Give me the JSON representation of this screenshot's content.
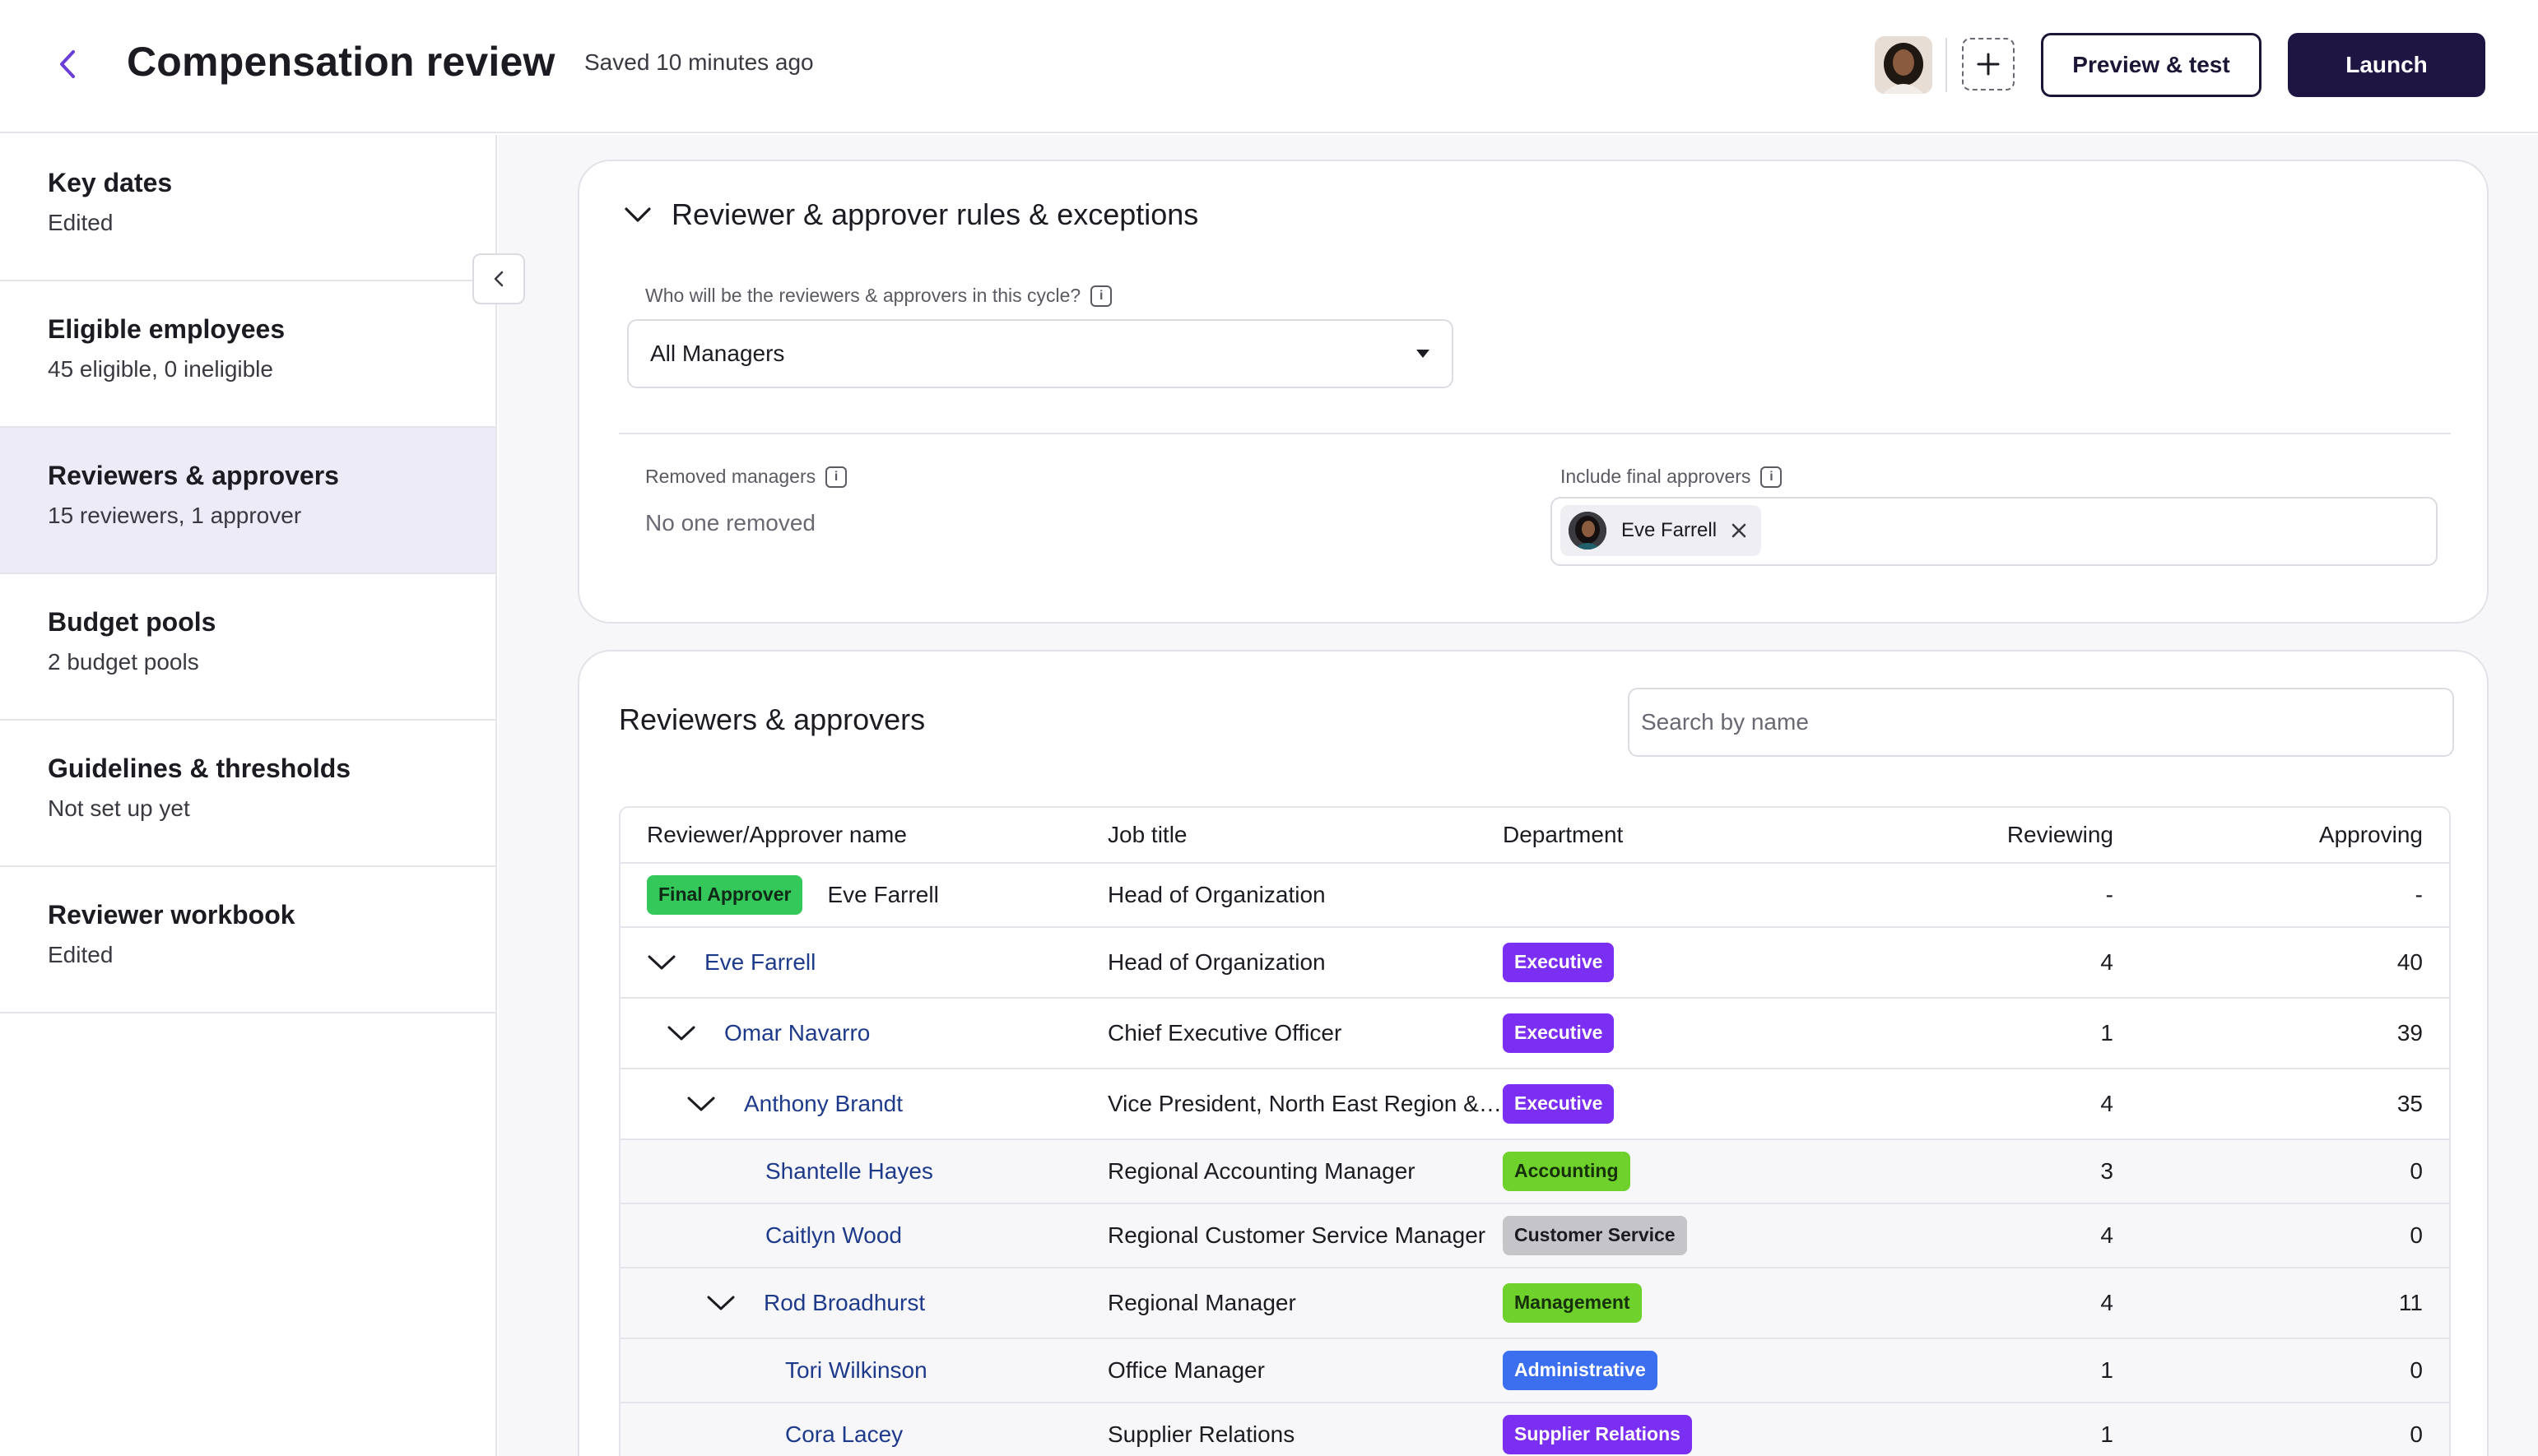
{
  "header": {
    "title": "Compensation review",
    "saved_status": "Saved 10 minutes ago",
    "preview_label": "Preview & test",
    "launch_label": "Launch"
  },
  "sidebar": {
    "items": [
      {
        "title": "Key dates",
        "subtitle": "Edited"
      },
      {
        "title": "Eligible employees",
        "subtitle": "45 eligible, 0 ineligible"
      },
      {
        "title": "Reviewers & approvers",
        "subtitle": "15 reviewers, 1 approver",
        "active": true
      },
      {
        "title": "Budget pools",
        "subtitle": "2 budget pools"
      },
      {
        "title": "Guidelines & thresholds",
        "subtitle": "Not set up yet"
      },
      {
        "title": "Reviewer workbook",
        "subtitle": "Edited"
      }
    ]
  },
  "rules": {
    "title": "Reviewer & approver rules & exceptions",
    "question": "Who will be the reviewers & approvers in this cycle?",
    "selected": "All Managers",
    "removed_label": "Removed managers",
    "removed_value": "No one removed",
    "final_label": "Include final approvers",
    "final_chip": "Eve Farrell"
  },
  "table": {
    "title": "Reviewers & approvers",
    "search_placeholder": "Search by name",
    "columns": {
      "name": "Reviewer/Approver name",
      "job": "Job title",
      "dept": "Department",
      "reviewing": "Reviewing",
      "approving": "Approving"
    },
    "final_badge": "Final Approver",
    "rows": [
      {
        "name": "Eve Farrell",
        "job": "Head of Organization",
        "dept": "",
        "reviewing": "-",
        "approving": "-"
      },
      {
        "name": "Eve Farrell",
        "job": "Head of Organization",
        "dept": "Executive",
        "reviewing": "4",
        "approving": "40"
      },
      {
        "name": "Omar Navarro",
        "job": "Chief Executive Officer",
        "dept": "Executive",
        "reviewing": "1",
        "approving": "39"
      },
      {
        "name": "Anthony Brandt",
        "job": "Vice President, North East Region & Operations",
        "dept": "Executive",
        "reviewing": "4",
        "approving": "35"
      },
      {
        "name": "Shantelle Hayes",
        "job": "Regional Accounting Manager",
        "dept": "Accounting",
        "reviewing": "3",
        "approving": "0"
      },
      {
        "name": "Caitlyn Wood",
        "job": "Regional Customer Service Manager",
        "dept": "Customer Service",
        "reviewing": "4",
        "approving": "0"
      },
      {
        "name": "Rod Broadhurst",
        "job": "Regional Manager",
        "dept": "Management",
        "reviewing": "4",
        "approving": "11"
      },
      {
        "name": "Tori Wilkinson",
        "job": "Office Manager",
        "dept": "Administrative",
        "reviewing": "1",
        "approving": "0"
      },
      {
        "name": "Cora Lacey",
        "job": "Supplier Relations",
        "dept": "Supplier Relations",
        "reviewing": "1",
        "approving": "0"
      }
    ]
  },
  "colors": {
    "accent": "#6b3fd6",
    "primary_button": "#1f1543",
    "active_nav": "#eeebf8",
    "executive": "#7b2ff2",
    "accounting": "#6fd12b",
    "customer_service": "#c5c4c9",
    "management": "#6fd12b",
    "administrative": "#3c6ef0",
    "final_approver": "#34c759"
  },
  "icons": {
    "back": "chevron-left-icon",
    "add": "plus-icon",
    "collapse": "chevron-left-icon",
    "section_toggle": "chevron-down-icon",
    "dropdown": "caret-down-icon",
    "info": "info-icon",
    "remove": "close-icon"
  }
}
